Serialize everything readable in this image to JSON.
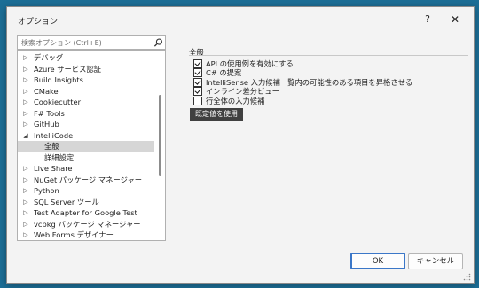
{
  "window": {
    "title": "オプション",
    "help_label": "?",
    "close_label": "✕"
  },
  "search": {
    "placeholder": "検索オプション (Ctrl+E)"
  },
  "tree": {
    "items": [
      {
        "label": "デバッグ",
        "arrow": "▷",
        "level": 0
      },
      {
        "label": "Azure サービス認証",
        "arrow": "▷",
        "level": 0
      },
      {
        "label": "Build Insights",
        "arrow": "▷",
        "level": 0
      },
      {
        "label": "CMake",
        "arrow": "▷",
        "level": 0
      },
      {
        "label": "Cookiecutter",
        "arrow": "▷",
        "level": 0
      },
      {
        "label": "F# Tools",
        "arrow": "▷",
        "level": 0
      },
      {
        "label": "GitHub",
        "arrow": "▷",
        "level": 0
      },
      {
        "label": "IntelliCode",
        "arrow": "◢",
        "level": 0
      },
      {
        "label": "全般",
        "arrow": "",
        "level": 1,
        "selected": true
      },
      {
        "label": "詳細設定",
        "arrow": "",
        "level": 1
      },
      {
        "label": "Live Share",
        "arrow": "▷",
        "level": 0
      },
      {
        "label": "NuGet パッケージ マネージャー",
        "arrow": "▷",
        "level": 0
      },
      {
        "label": "Python",
        "arrow": "▷",
        "level": 0
      },
      {
        "label": "SQL Server ツール",
        "arrow": "▷",
        "level": 0
      },
      {
        "label": "Test Adapter for Google Test",
        "arrow": "▷",
        "level": 0
      },
      {
        "label": "vcpkg パッケージ マネージャー",
        "arrow": "▷",
        "level": 0
      },
      {
        "label": "Web Forms デザイナー",
        "arrow": "▷",
        "level": 0
      }
    ]
  },
  "panel": {
    "title": "全般",
    "options": [
      {
        "label": "API の使用例を有効にする",
        "checked": true
      },
      {
        "label": "C# の提案",
        "checked": true
      },
      {
        "label": "IntelliSense 入力候補一覧内の可能性のある項目を昇格させる",
        "checked": true
      },
      {
        "label": "インライン差分ビュー",
        "checked": true
      },
      {
        "label": "行全体の入力候補",
        "checked": false
      }
    ],
    "tooltip": "既定値を使用"
  },
  "buttons": {
    "ok": "OK",
    "cancel": "キャンセル"
  }
}
